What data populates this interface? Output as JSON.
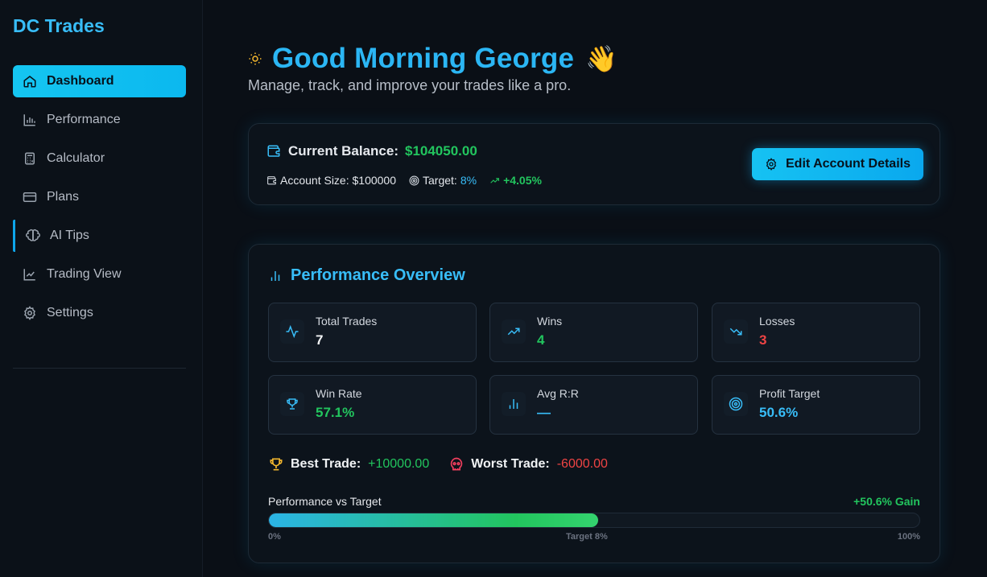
{
  "app": {
    "brand": "DC Trades"
  },
  "sidebar": {
    "items": [
      {
        "label": "Dashboard",
        "icon": "home-icon",
        "active": true
      },
      {
        "label": "Performance",
        "icon": "bar-chart-icon"
      },
      {
        "label": "Calculator",
        "icon": "calculator-icon"
      },
      {
        "label": "Plans",
        "icon": "credit-card-icon"
      },
      {
        "label": "AI Tips",
        "icon": "brain-icon"
      },
      {
        "label": "Trading View",
        "icon": "line-chart-icon"
      },
      {
        "label": "Settings",
        "icon": "gear-icon"
      }
    ]
  },
  "header": {
    "greeting": "Good Morning George",
    "wave": "👋",
    "subtitle": "Manage, track, and improve your trades like a pro."
  },
  "balance": {
    "label": "Current Balance:",
    "value": "$104050.00",
    "account_size_label": "Account Size:",
    "account_size": "$100000",
    "target_label": "Target:",
    "target": "8%",
    "change": "+4.05%",
    "edit_button": "Edit Account Details"
  },
  "performance": {
    "title": "Performance Overview",
    "stats": [
      {
        "label": "Total Trades",
        "value": "7",
        "icon": "activity-icon"
      },
      {
        "label": "Wins",
        "value": "4",
        "icon": "trending-up-icon"
      },
      {
        "label": "Losses",
        "value": "3",
        "icon": "trending-down-icon"
      },
      {
        "label": "Win Rate",
        "value": "57.1%",
        "icon": "trophy-icon"
      },
      {
        "label": "Avg R:R",
        "value": "—",
        "icon": "bar-chart-icon"
      },
      {
        "label": "Profit Target",
        "value": "50.6%",
        "icon": "target-icon"
      }
    ],
    "best_trade_label": "Best Trade:",
    "best_trade": "+10000.00",
    "worst_trade_label": "Worst Trade:",
    "worst_trade": "-6000.00",
    "progress_label": "Performance vs Target",
    "progress_gain": "+50.6% Gain",
    "progress_fraction": 0.506,
    "tick_start": "0%",
    "tick_target": "Target 8%",
    "tick_end": "100%"
  },
  "colors": {
    "accent": "#38bdf8",
    "positive": "#22c55e",
    "negative": "#ef4444",
    "background": "#0a0f16"
  }
}
